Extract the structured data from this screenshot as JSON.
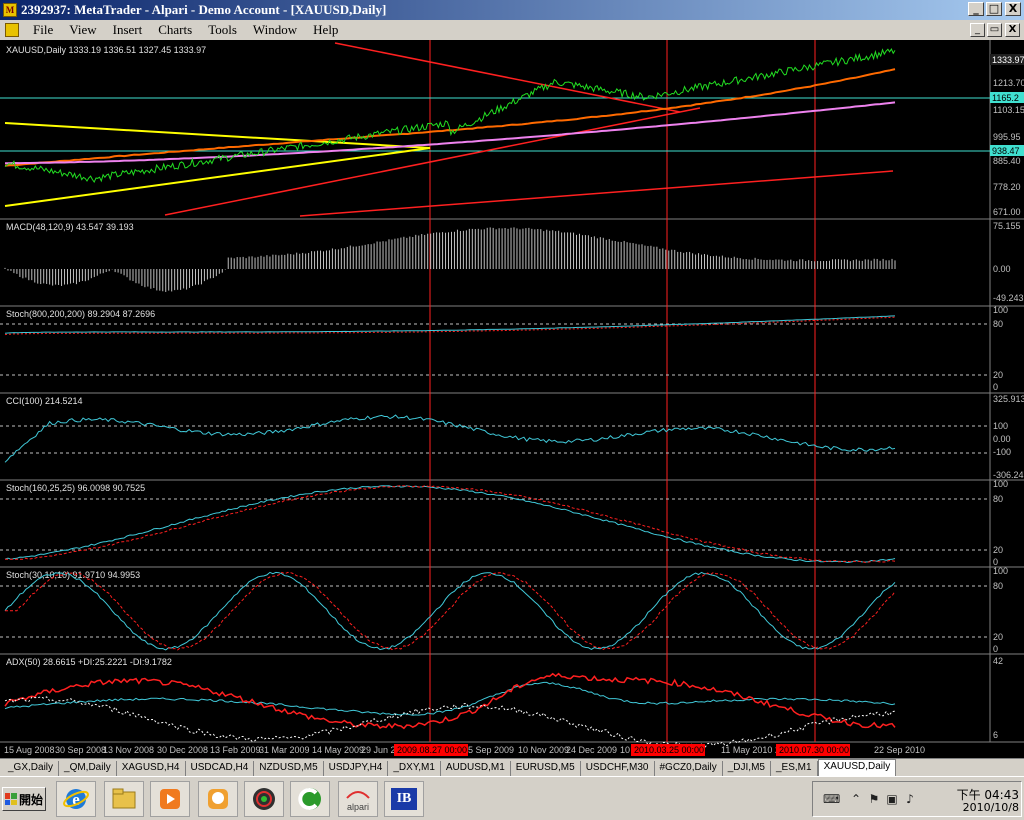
{
  "window": {
    "title": "2392937: MetaTrader - Alpari - Demo Account - [XAUUSD,Daily]",
    "controls": {
      "minimize": "_",
      "maximize": "□",
      "close": "X"
    }
  },
  "menu": {
    "items": [
      "File",
      "View",
      "Insert",
      "Charts",
      "Tools",
      "Window",
      "Help"
    ],
    "mdi_controls": {
      "minimize": "_",
      "restore": "▭",
      "close": "X"
    }
  },
  "colors": {
    "background": "#000000",
    "price_line": "#22dd22",
    "trendline": "#ff2020",
    "fan_line": "#ffff00",
    "ma_orange": "#ff6a00",
    "ma_violet": "#ee82ee",
    "level_cyan": "#40e0d0",
    "macd_hist": "#c0c0c0",
    "signal_red": "#ff2020",
    "osc_line": "#40c8d8",
    "adx_white": "#ffffff",
    "adx_red": "#ff2020",
    "tag_bg": "#ff0000"
  },
  "chart": {
    "symbol_header": "XAUUSD,Daily  1333.19 1336.51 1327.45 1333.97",
    "price_tags": [
      "1333.97",
      "1165.2",
      "938.47"
    ],
    "price_axis": [
      "1213.70",
      "1103.15",
      "995.95",
      "885.40",
      "778.20",
      "671.00"
    ],
    "panels": [
      {
        "name": "macd",
        "title": "MACD(48,120,9) 43.547 39.193",
        "levels": [
          "75.155",
          "0.00",
          "-49.243"
        ]
      },
      {
        "name": "stoch-800",
        "title": "Stoch(800,200,200) 89.2904 87.2696",
        "levels": [
          "100",
          "80",
          "20",
          "0"
        ]
      },
      {
        "name": "cci",
        "title": "CCI(100) 214.5214",
        "levels": [
          "325.9138",
          "100",
          "0.00",
          "-100",
          "-306.247"
        ]
      },
      {
        "name": "stoch-160",
        "title": "Stoch(160,25,25) 96.0098 90.7525",
        "levels": [
          "100",
          "80",
          "20",
          "0"
        ]
      },
      {
        "name": "stoch-30",
        "title": "Stoch(30,10,10) 91.9710 94.9953",
        "levels": [
          "100",
          "80",
          "20",
          "0"
        ]
      },
      {
        "name": "adx",
        "title": "ADX(50) 28.6615 +DI:25.2221 -DI:9.1782",
        "levels": [
          "42",
          "6"
        ]
      }
    ],
    "x_labels": [
      "15 Aug 2008",
      "30 Sep 2008",
      "13 Nov 2008",
      "30 Dec 2008",
      "13 Feb 2009",
      "31 Mar 2009",
      "14 May 2009",
      "29 Jun 2009",
      "5 Sep 2009",
      "10 Nov 2009",
      "24 Dec 2009",
      "10",
      "11 May 2010",
      "2",
      "22 Sep 2010"
    ],
    "x_tags": [
      "2009.08.27 00:00",
      "2010.03.25 00:00",
      "2010.07.30 00:00"
    ]
  },
  "tabs": [
    "_GX,Daily",
    "_QM,Daily",
    "XAGUSD,H4",
    "USDCAD,H4",
    "NZDUSD,M5",
    "USDJPY,H4",
    "_DXY,M1",
    "AUDUSD,M1",
    "EURUSD,M5",
    "USDCHF,M30",
    "#GCZ0,Daily",
    "_DJI,M5",
    "_ES,M1",
    "XAUUSD,Daily"
  ],
  "taskbar": {
    "start_label": "開始",
    "apps": [
      "internet-explorer",
      "file-explorer",
      "media-player",
      "messenger",
      "chart-app",
      "browser",
      "alpari",
      "ib"
    ],
    "alpari_label": "alpari",
    "ib_label": "IB",
    "clock_time": "下午 04:43",
    "clock_date": "2010/10/8"
  }
}
